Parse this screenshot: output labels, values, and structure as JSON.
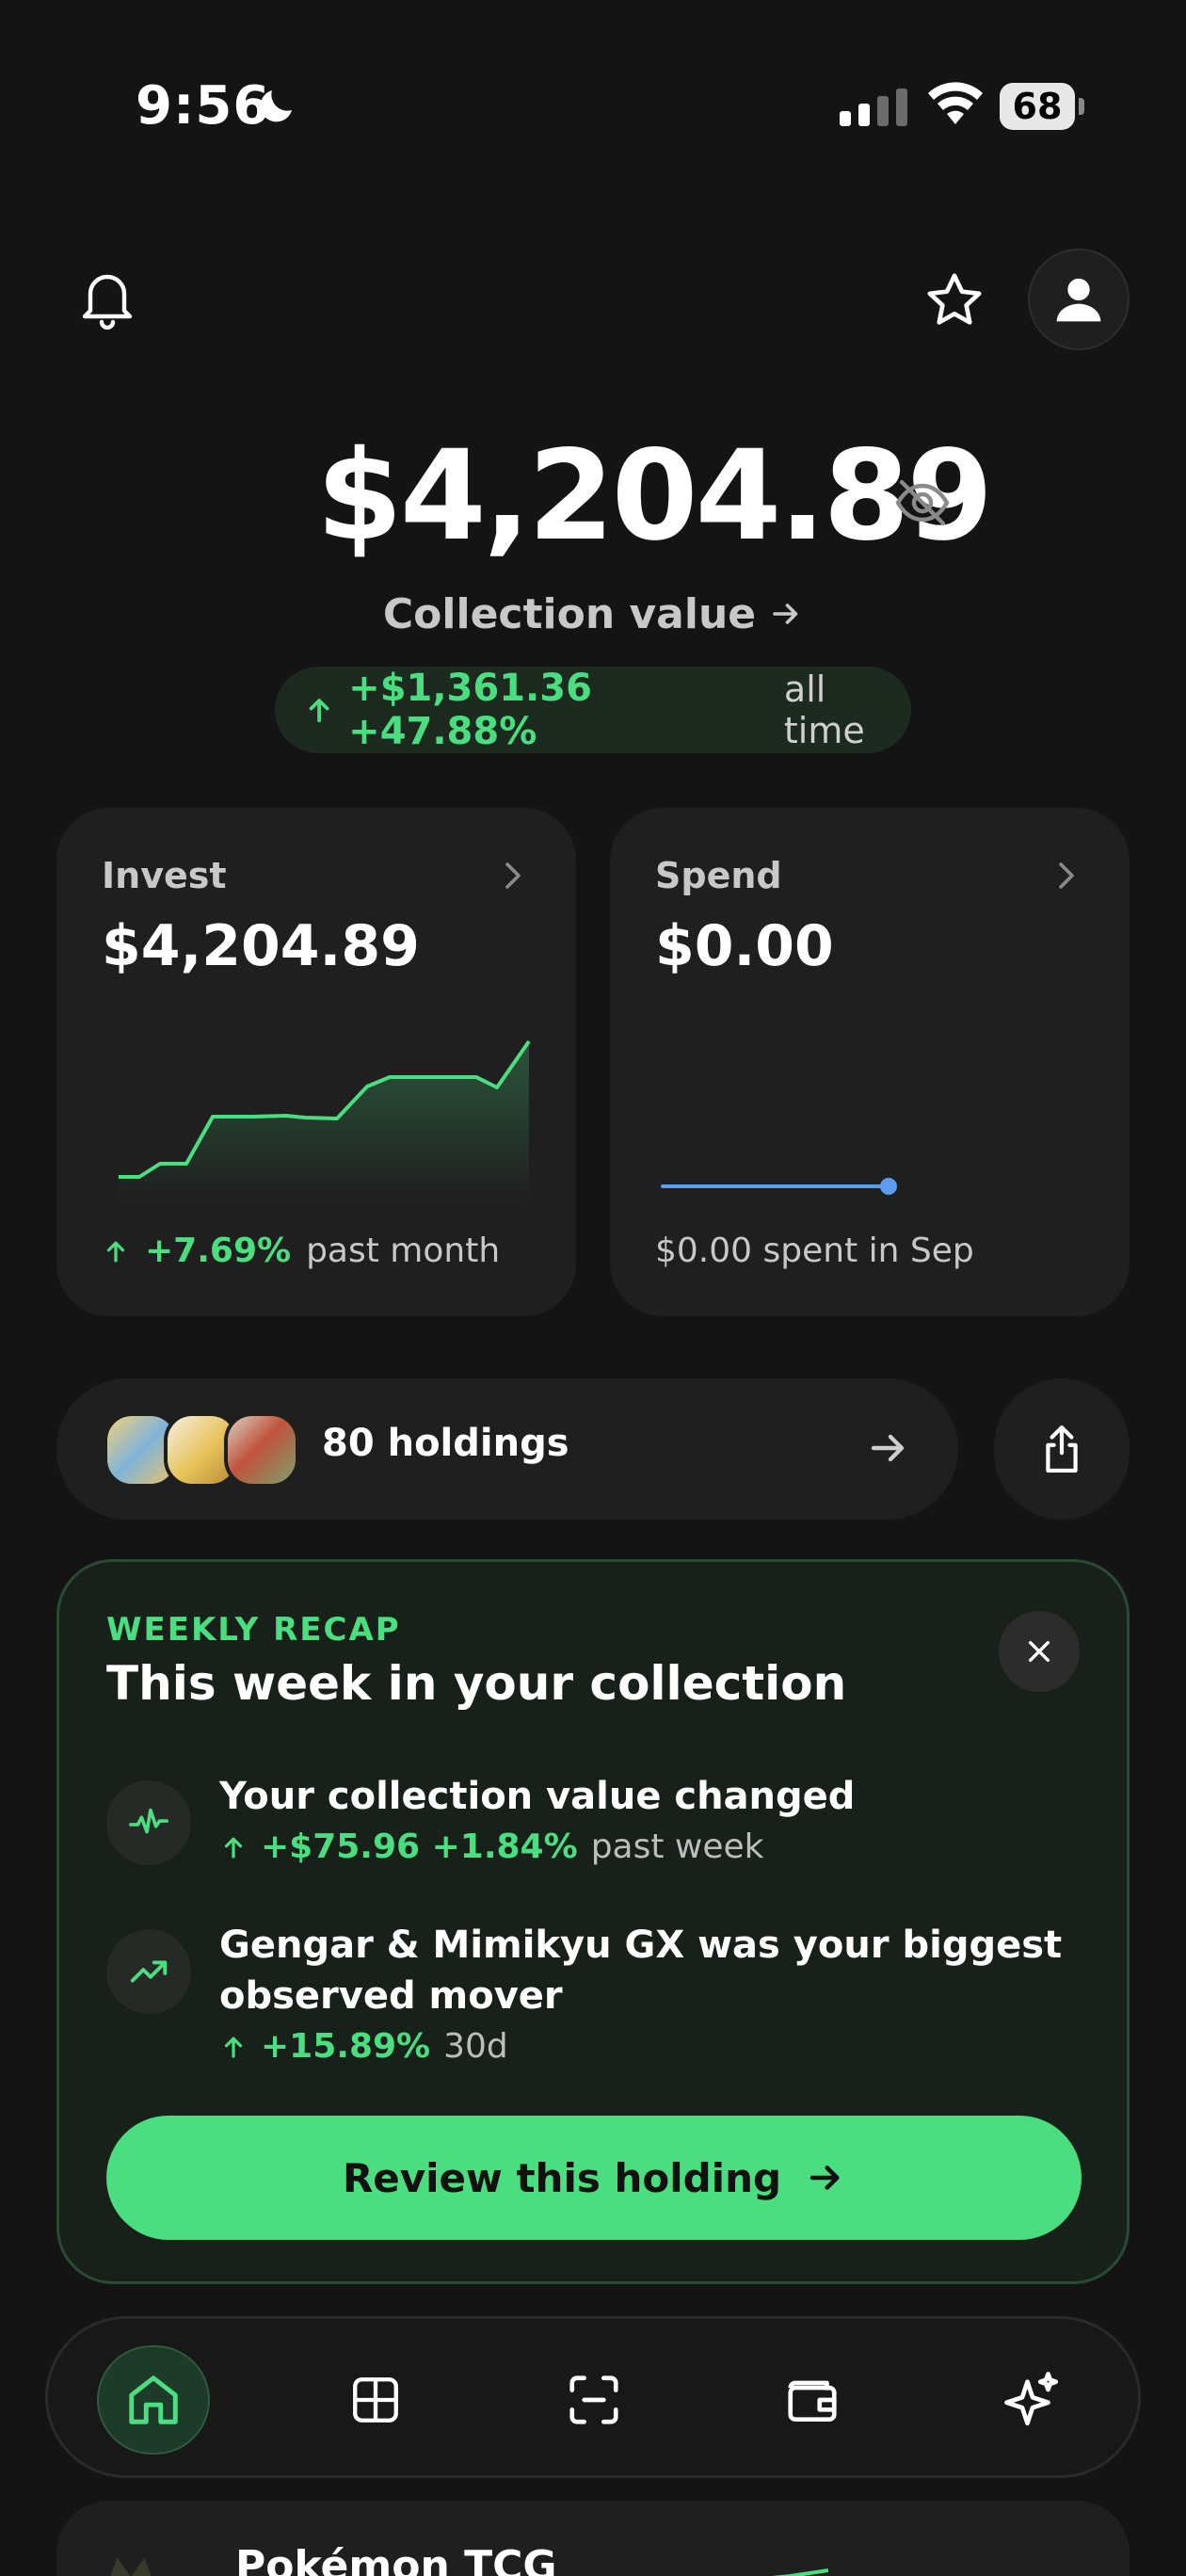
{
  "status_bar": {
    "time": "9:56",
    "battery": "68"
  },
  "hero": {
    "value": "$4,204.89",
    "subtitle": "Collection value",
    "change_amount": "+$1,361.36 +47.88%",
    "change_period": "all time"
  },
  "cards": {
    "invest": {
      "label": "Invest",
      "value": "$4,204.89",
      "change": "+7.69%",
      "period": "past month"
    },
    "spend": {
      "label": "Spend",
      "value": "$0.00",
      "note": "$0.00 spent in Sep"
    }
  },
  "holdings": {
    "label": "80 holdings"
  },
  "recap": {
    "eyebrow": "WEEKLY RECAP",
    "title": "This week in your collection",
    "item1_text": "Your collection value changed",
    "item1_change": "+$75.96 +1.84%",
    "item1_period": "past week",
    "item2_text": "Gengar & Mimikyu GX was your biggest observed mover",
    "item2_change": "+15.89%",
    "item2_period": "30d",
    "cta": "Review this holding"
  },
  "peek": {
    "title": "Pokémon TCG"
  },
  "colors": {
    "accent_green": "#4ade80",
    "background": "#141414",
    "card": "#1f1f1f",
    "spend_line": "#5b9cf0"
  },
  "icons": [
    "moon-icon",
    "signal-icon",
    "wifi-icon",
    "bell-icon",
    "star-icon",
    "user-icon",
    "eye-off-icon",
    "arrow-right-icon",
    "arrow-up-icon",
    "chevron-right-icon",
    "share-icon",
    "close-icon",
    "pulse-icon",
    "trending-up-icon",
    "home-icon",
    "grid-icon",
    "scan-icon",
    "wallet-icon",
    "sparkle-icon"
  ]
}
